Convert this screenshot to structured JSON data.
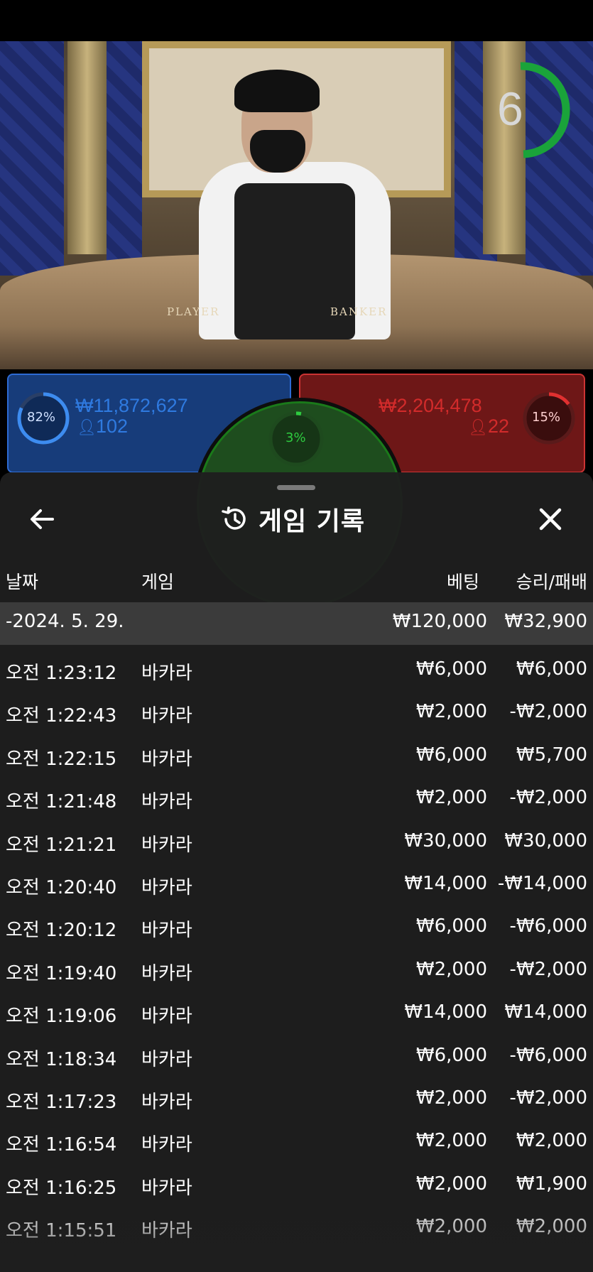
{
  "timer": {
    "value": "6"
  },
  "table_labels": {
    "player": "PLAYER",
    "banker": "BANKER"
  },
  "player_bet": {
    "percent": "82%",
    "amount": "₩11,872,627",
    "players": "102",
    "color": "#2d6bd4"
  },
  "banker_bet": {
    "percent": "15%",
    "amount": "₩2,204,478",
    "players": "22",
    "color": "#c33333"
  },
  "tie_bet": {
    "percent": "3%",
    "color": "#22aa22"
  },
  "history_panel": {
    "title": "게임 기록",
    "icons": {
      "back": "back-arrow-icon",
      "history": "history-icon",
      "close": "close-icon"
    },
    "columns": {
      "date": "날짜",
      "game": "게임",
      "bet": "베팅",
      "result": "승리/패배"
    },
    "date_group": {
      "date": "-2024. 5. 29.",
      "total_bet": "₩120,000",
      "total_result": "₩32,900"
    },
    "rows": [
      {
        "time": "오전 1:23:12",
        "game": "바카라",
        "bet": "₩6,000",
        "result": "₩6,000"
      },
      {
        "time": "오전 1:22:43",
        "game": "바카라",
        "bet": "₩2,000",
        "result": "-₩2,000"
      },
      {
        "time": "오전 1:22:15",
        "game": "바카라",
        "bet": "₩6,000",
        "result": "₩5,700"
      },
      {
        "time": "오전 1:21:48",
        "game": "바카라",
        "bet": "₩2,000",
        "result": "-₩2,000"
      },
      {
        "time": "오전 1:21:21",
        "game": "바카라",
        "bet": "₩30,000",
        "result": "₩30,000"
      },
      {
        "time": "오전 1:20:40",
        "game": "바카라",
        "bet": "₩14,000",
        "result": "-₩14,000"
      },
      {
        "time": "오전 1:20:12",
        "game": "바카라",
        "bet": "₩6,000",
        "result": "-₩6,000"
      },
      {
        "time": "오전 1:19:40",
        "game": "바카라",
        "bet": "₩2,000",
        "result": "-₩2,000"
      },
      {
        "time": "오전 1:19:06",
        "game": "바카라",
        "bet": "₩14,000",
        "result": "₩14,000"
      },
      {
        "time": "오전 1:18:34",
        "game": "바카라",
        "bet": "₩6,000",
        "result": "-₩6,000"
      },
      {
        "time": "오전 1:17:23",
        "game": "바카라",
        "bet": "₩2,000",
        "result": "-₩2,000"
      },
      {
        "time": "오전 1:16:54",
        "game": "바카라",
        "bet": "₩2,000",
        "result": "₩2,000"
      },
      {
        "time": "오전 1:16:25",
        "game": "바카라",
        "bet": "₩2,000",
        "result": "₩1,900"
      },
      {
        "time": "오전 1:15:51",
        "game": "바카라",
        "bet": "₩2,000",
        "result": "₩2,000"
      }
    ]
  }
}
